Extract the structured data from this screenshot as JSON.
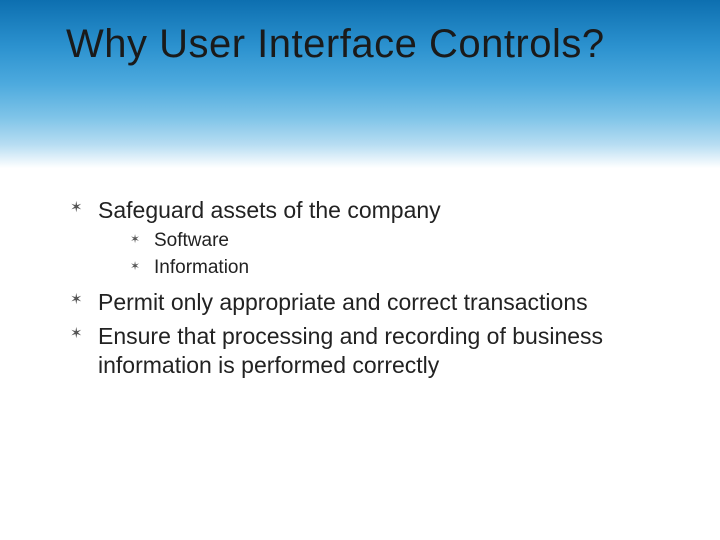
{
  "title": "Why User Interface Controls?",
  "bullets": {
    "b1": {
      "text": "Safeguard assets of the company",
      "sub": {
        "s1": "Software",
        "s2": "Information"
      }
    },
    "b2": {
      "text": "Permit only appropriate and correct transactions"
    },
    "b3": {
      "text": "Ensure that processing and recording of business information is performed correctly"
    }
  }
}
